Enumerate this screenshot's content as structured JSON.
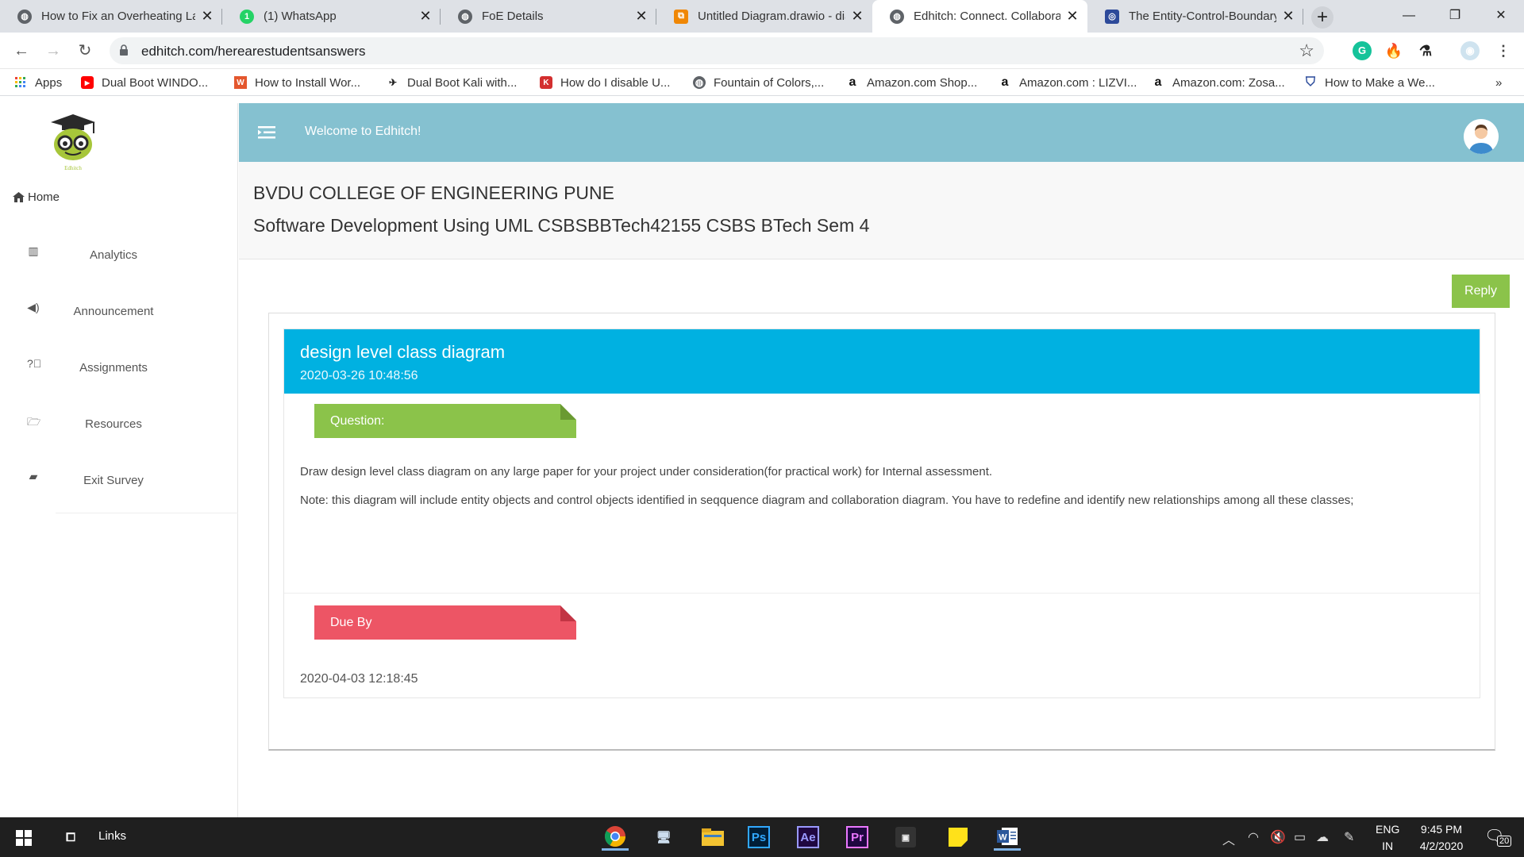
{
  "browser": {
    "tabs": [
      {
        "title": "How to Fix an Overheating Laptop",
        "icon": "globe-icon"
      },
      {
        "title": "(1) WhatsApp",
        "icon": "whatsapp-icon",
        "badge": "1"
      },
      {
        "title": "FoE Details",
        "icon": "globe-icon"
      },
      {
        "title": "Untitled Diagram.drawio - diagrams.net",
        "icon": "drawio-icon"
      },
      {
        "title": "Edhitch: Connect. Collaborate",
        "icon": "globe-icon"
      },
      {
        "title": "The Entity-Control-Boundary",
        "icon": "site-icon"
      }
    ],
    "url": "edhitch.com/herearestudentsanswers",
    "bookmarks": [
      {
        "label": "Apps",
        "icon": "apps-grid-icon"
      },
      {
        "label": "Dual Boot WINDO...",
        "icon": "youtube-icon"
      },
      {
        "label": "How to Install Wor...",
        "icon": "wordpress-icon"
      },
      {
        "label": "Dual Boot Kali with...",
        "icon": "kali-icon"
      },
      {
        "label": "How do I disable U...",
        "icon": "red-site-icon"
      },
      {
        "label": "Fountain of Colors,...",
        "icon": "globe-icon"
      },
      {
        "label": "Amazon.com Shop...",
        "icon": "amazon-icon"
      },
      {
        "label": "Amazon.com : LIZVI...",
        "icon": "amazon-icon"
      },
      {
        "label": "Amazon.com: Zosa...",
        "icon": "amazon-icon"
      },
      {
        "label": "How to Make a We...",
        "icon": "shield-icon"
      }
    ],
    "bookmarks_more": "»"
  },
  "sidebar": {
    "home": "Home",
    "items": [
      {
        "label": "Analytics",
        "icon": "bar-chart-icon"
      },
      {
        "label": "Announcement",
        "icon": "megaphone-icon"
      },
      {
        "label": "Assignments",
        "icon": "question-circle-icon"
      },
      {
        "label": "Resources",
        "icon": "folder-open-icon"
      },
      {
        "label": "Exit Survey",
        "icon": "comments-icon"
      }
    ]
  },
  "topbar": {
    "welcome": "Welcome to Edhitch!"
  },
  "header": {
    "college": "BVDU COLLEGE OF ENGINEERING PUNE",
    "course": "Software Development Using UML CSBSBBTech42155 CSBS BTech Sem 4"
  },
  "reply_label": "Reply",
  "question": {
    "title": "design level class diagram",
    "posted": "2020-03-26 10:48:56",
    "question_label": "Question:",
    "text1": "Draw design level class diagram on any large paper for your project under consideration(for practical work) for Internal assessment.",
    "text2": "Note: this diagram will include entity objects and control objects identified in seqquence diagram and collaboration diagram. You have to redefine and identify new relationships among all these classes;",
    "due_label": "Due By",
    "due_date": "2020-04-03 12:18:45"
  },
  "taskbar": {
    "links": "Links",
    "lang_top": "ENG",
    "lang_bottom": "IN",
    "time": "9:45 PM",
    "date": "4/2/2020",
    "notifications": "20"
  },
  "colors": {
    "topbar": "#85c1d0",
    "card_header": "#00b1e1",
    "question_ribbon": "#8bc34a",
    "due_ribbon": "#ed5565",
    "reply_button": "#8bc34a"
  }
}
